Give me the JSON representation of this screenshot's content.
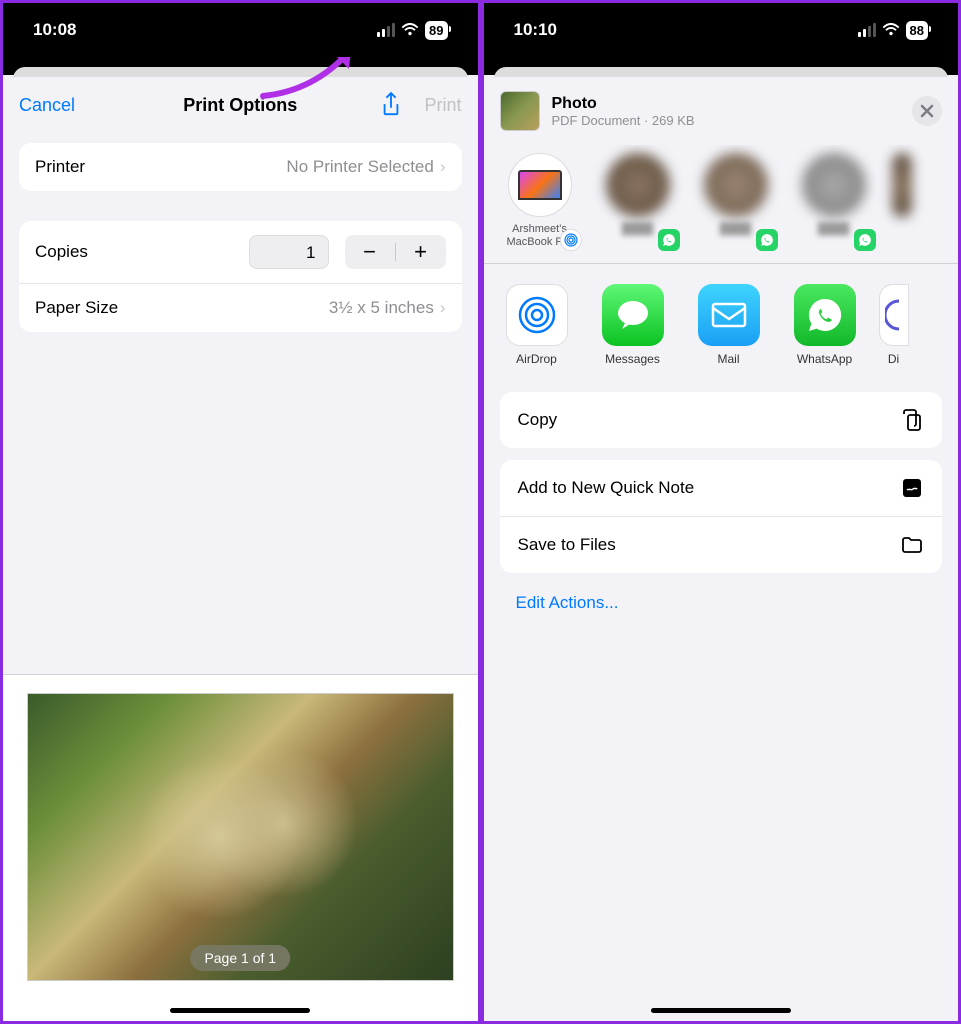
{
  "left": {
    "status": {
      "time": "10:08",
      "battery": "89"
    },
    "nav": {
      "cancel": "Cancel",
      "title": "Print Options",
      "print": "Print"
    },
    "printer": {
      "label": "Printer",
      "value": "No Printer Selected"
    },
    "copies": {
      "label": "Copies",
      "value": "1"
    },
    "paper": {
      "label": "Paper Size",
      "value": "3½ x 5 inches"
    },
    "page_badge": "Page 1 of 1"
  },
  "right": {
    "status": {
      "time": "10:10",
      "battery": "88"
    },
    "doc": {
      "title": "Photo",
      "meta": "PDF Document · 269 KB"
    },
    "contacts": [
      {
        "name": "Arshmeet's MacBook Pro"
      }
    ],
    "apps": {
      "airdrop": "AirDrop",
      "messages": "Messages",
      "mail": "Mail",
      "whatsapp": "WhatsApp",
      "partial": "Di"
    },
    "actions": {
      "copy": "Copy",
      "quick_note": "Add to New Quick Note",
      "save_files": "Save to Files",
      "edit": "Edit Actions..."
    }
  }
}
